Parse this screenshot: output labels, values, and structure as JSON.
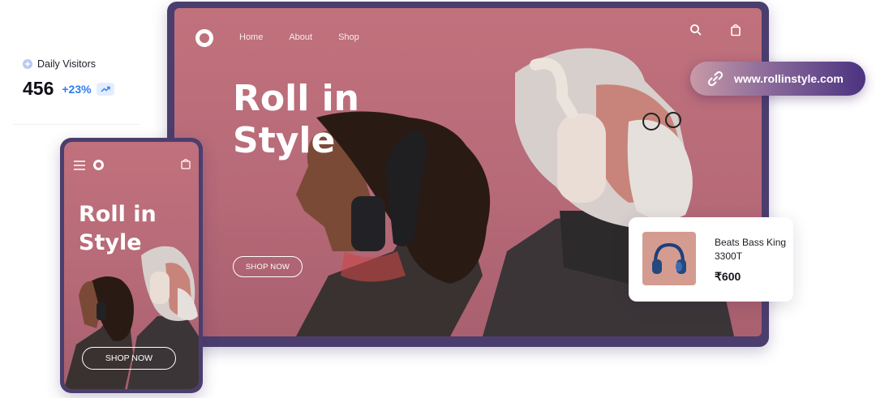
{
  "stats": {
    "label": "Daily Visitors",
    "value": "456",
    "growth": "+23%",
    "icon": "sparkle-icon",
    "trend_icon": "trend-up-icon",
    "accent_color": "#2f7df0"
  },
  "desktop": {
    "nav": [
      {
        "label": "Home"
      },
      {
        "label": "About"
      },
      {
        "label": "Shop"
      }
    ],
    "hero_title_line1": "Roll in",
    "hero_title_line2": "Style",
    "cta_label": "SHOP NOW",
    "background_color": "#b96c79",
    "frame_color": "#4b3e6e"
  },
  "url_pill": {
    "url": "www.rollinstyle.com",
    "icon": "link-icon"
  },
  "product": {
    "name": "Beats Bass King 3300T",
    "price": "₹600",
    "thumb_color": "#d49c90"
  },
  "mobile": {
    "hero_title_line1": "Roll in",
    "hero_title_line2": "Style",
    "cta_label": "SHOP NOW"
  }
}
